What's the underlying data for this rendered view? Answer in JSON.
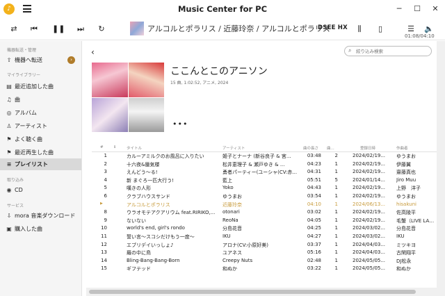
{
  "app": {
    "title": "Music Center for PC"
  },
  "player": {
    "track_display": "アルコルとポラリス / 近藤玲奈 / アルコルとポラリス",
    "dsee_label": "DSEE HX",
    "time": "01:08/04:10"
  },
  "sidebar": {
    "sections": [
      {
        "label": "機器転送・管理"
      },
      {
        "label": "マイライブラリー"
      },
      {
        "label": "取り込み"
      },
      {
        "label": "サービス"
      }
    ],
    "items": [
      {
        "label": "機器へ転送",
        "icon": "upload-icon"
      },
      {
        "label": "最近追加した曲",
        "icon": "list-icon"
      },
      {
        "label": "曲",
        "icon": "music-note-icon"
      },
      {
        "label": "アルバム",
        "icon": "disc-icon"
      },
      {
        "label": "アーティスト",
        "icon": "person-icon"
      },
      {
        "label": "よく聴く曲",
        "icon": "flag-icon"
      },
      {
        "label": "最近再生した曲",
        "icon": "flag-icon"
      },
      {
        "label": "プレイリスト",
        "icon": "playlist-icon",
        "active": true
      },
      {
        "label": "CD",
        "icon": "cd-icon"
      },
      {
        "label": "mora 音楽ダウンロード",
        "icon": "download-icon"
      },
      {
        "label": "購入した曲",
        "icon": "bag-icon"
      }
    ]
  },
  "album": {
    "title": "ここんとこのアニソン",
    "meta": "15 曲, 1:02:52, アニメ, 2024"
  },
  "search": {
    "placeholder": "絞り込み検索"
  },
  "table": {
    "headers": {
      "num": "#",
      "title": "タイトル",
      "artist": "アーティスト",
      "length": "曲の長さ",
      "disc": "曲...",
      "date": "登録日時",
      "composer": "作曲者"
    },
    "rows": [
      {
        "num": "1",
        "title": "カルーアミルクのお風呂に入りたい",
        "artist": "姫子とナーナ (新谷良子 & 宮...",
        "length": "03:48",
        "disc": "2",
        "date": "2024/02/19...",
        "composer": "ゆうまお"
      },
      {
        "num": "2",
        "title": "十六夜&蜃気楼",
        "artist": "松井恵理子 & 瀬戸ゆき & ...",
        "length": "04:23",
        "disc": "1",
        "date": "2024/02/19...",
        "composer": "伊藤翼"
      },
      {
        "num": "3",
        "title": "えんどう〜る!",
        "artist": "勇者パーティー(ユーシャ(CV:赤...",
        "length": "04:31",
        "disc": "1",
        "date": "2024/02/19...",
        "composer": "齋藤真也"
      },
      {
        "num": "4",
        "title": "新 まぐろ一匹大行う!",
        "artist": "藍上",
        "length": "05:51",
        "disc": "5",
        "date": "2024/01/14...",
        "composer": "Jiro Muu"
      },
      {
        "num": "5",
        "title": "嘆きの人形",
        "artist": "Yoko",
        "length": "04:43",
        "disc": "1",
        "date": "2024/02/19...",
        "composer": "上野　洋子"
      },
      {
        "num": "6",
        "title": "クラブハウスサンド",
        "artist": "ゆうまお",
        "length": "03:54",
        "disc": "1",
        "date": "2024/02/19...",
        "composer": "ゆうまお"
      },
      {
        "num": "7",
        "title": "アルコルとポラリス",
        "artist": "近藤玲奈",
        "length": "04:10",
        "disc": "1",
        "date": "2024/06/13...",
        "composer": "hisakuni",
        "playing": true
      },
      {
        "num": "8",
        "title": "ウラオモテアクアリウム feat.RIRIKO,...",
        "artist": "otonari",
        "length": "03:02",
        "disc": "1",
        "date": "2024/02/19...",
        "composer": "佐高陵平"
      },
      {
        "num": "9",
        "title": "ないない",
        "artist": "ReoNa",
        "length": "04:05",
        "disc": "1",
        "date": "2024/02/19...",
        "composer": "毛蟹（LIVE LAB.)"
      },
      {
        "num": "10",
        "title": "world's end, girl's rondo",
        "artist": "分島花音",
        "length": "04:25",
        "disc": "1",
        "date": "2024/03/02...",
        "composer": "分島花音"
      },
      {
        "num": "11",
        "title": "誓い言〜スコシだけもう一度〜",
        "artist": "IKU",
        "length": "04:27",
        "disc": "1",
        "date": "2024/03/02...",
        "composer": "IKU"
      },
      {
        "num": "12",
        "title": "エブリデイいっしょ♪",
        "artist": "アロナ(CV:小原好美)",
        "length": "03:37",
        "disc": "1",
        "date": "2024/04/03...",
        "composer": "ミツキヨ"
      },
      {
        "num": "13",
        "title": "羅の中に鳥",
        "artist": "ユアネス",
        "length": "05:16",
        "disc": "1",
        "date": "2024/04/03...",
        "composer": "古閑翔平"
      },
      {
        "num": "14",
        "title": "Bling-Bang-Bang-Born",
        "artist": "Creepy Nuts",
        "length": "02:48",
        "disc": "1",
        "date": "2024/05/05...",
        "composer": "DJ松永"
      },
      {
        "num": "15",
        "title": "ギフテッド",
        "artist": "和ぬか",
        "length": "03:22",
        "disc": "1",
        "date": "2024/05/05...",
        "composer": "和ぬか"
      }
    ]
  },
  "colors": {
    "accent": "#c79a3a",
    "logo": "#f3b21b",
    "active_bg": "#d9d9d9"
  }
}
